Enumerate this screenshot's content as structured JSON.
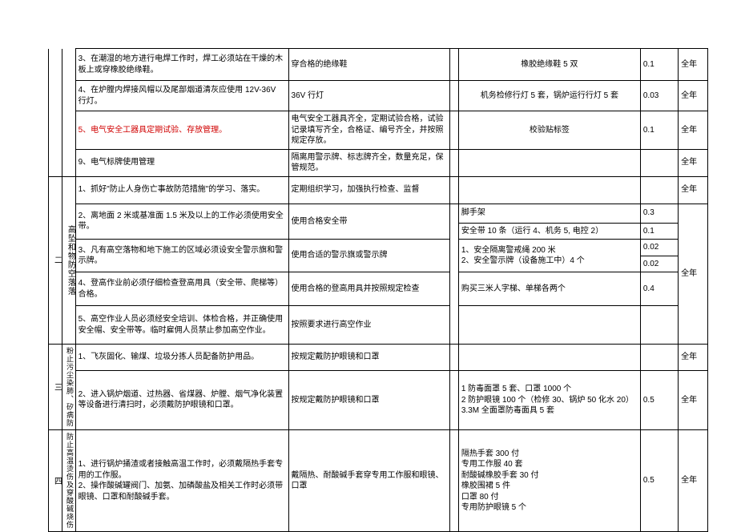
{
  "sections": {
    "s2_idx": "二",
    "s2_cat": "高坠和物防空落落",
    "s3_idx": "三",
    "s3_cat": "粉止污尘染肺、矽病防",
    "s4_idx": "四",
    "s4_cat": "防止高温烫伤及穿酸碱烧伤"
  },
  "rows": {
    "r1": {
      "item": "3、在潮湿的地方进行电焊工作时，焊工必须站在干燥的木板上或穿橡胶绝缘鞋。",
      "std": "穿合格的绝缘鞋",
      "mat": "橡胶绝缘鞋 5 双",
      "amt": "0.1",
      "per": "全年"
    },
    "r2": {
      "item": "4、在炉膛内焊接风帽以及尾部烟道清灰应使用 12V-36V 行灯。",
      "std": "36V 行灯",
      "mat": "机务检修行灯 5 套，锅炉运行行灯 5 套",
      "amt": "0.03",
      "per": "全年"
    },
    "r3": {
      "item": "5、电气安全工器具定期试验、存放管理。",
      "std": "电气安全工器具齐全，定期试验合格，试验记录填写齐全，合格证、编号齐全，并按照规定存放。",
      "mat": "校验贴标签",
      "amt": "0.1",
      "per": "全年"
    },
    "r4": {
      "item": "9、电气标牌使用管理",
      "std": "隔离用警示牌、标志牌齐全，数量充足，保管规范。",
      "mat": "",
      "amt": "",
      "per": "全年"
    },
    "r5": {
      "item": "1、抓好\"防止人身伤亡事故防范措施\"的学习、落实。",
      "std": "定期组织学习，加强执行检查、监督",
      "mat": "",
      "amt": "",
      "per": "全年"
    },
    "r6": {
      "item": "2、离地面 2 米或基准面 1.5 米及以上的工作必须使用安全带。",
      "std": "使用合格安全带",
      "mat1": "脚手架",
      "amt1": "0.3",
      "mat2": "安全带 10 条（运行 4、机务 5, 电控 2）",
      "amt2": "0.1"
    },
    "r7": {
      "item": "3、凡有高空落物和地下施工的区域必须设安全警示旗和警示牌。",
      "std": "使用合适的警示旗或警示牌",
      "mat1": "1、安全隔离警戒绳 200 米",
      "amt1": "0.02",
      "mat2": "2、安全警示牌（设备施工中）4 个",
      "amt2": "0.02"
    },
    "r8": {
      "item": "4、登高作业前必须仔细检查登高用具（安全带、爬梯等）合格。",
      "std": "使用合格的登高用具并按照规定检查",
      "mat": "购买三米人字梯、单梯各两个",
      "amt": "0.4",
      "per": "全年"
    },
    "r9": {
      "item": "5、高空作业人员必须经安全培训、体检合格，并正确使用安全帽、安全带等。临时雇佣人员禁止参加高空作业。",
      "std": "按照要求进行高空作业",
      "mat": "",
      "amt": ""
    },
    "r10": {
      "item": "1、飞灰固化、输煤、垃圾分拣人员配备防护用品。",
      "std": "按规定戴防护眼镜和口罩",
      "mat": "",
      "amt": "",
      "per": "全年"
    },
    "r11": {
      "item": "2、进入锅炉烟道、过热器、省煤器、炉膛、烟气净化装置等设备进行清扫时，必须戴防护眼镜和口罩。",
      "std": "按规定戴防护眼镜和口罩",
      "mat": "1 防毒面罩 5 套、口罩 1000 个\n2 防护眼镜 100 个（检修 30、锅炉 50 化水 20）\n3.3M 全面罩防毒面具 5 套",
      "amt": "0.5",
      "per": "全年"
    },
    "r12": {
      "item": "1、进行锅炉捅渣或者接触高温工作时，必须戴隔热手套专用的工作服。\n2、操作酸碱罐阀门、加氨、加磷酸盐及相关工作时必须带眼镜、口罩和耐酸碱手套。",
      "std": "戴隔热、耐酸碱手套穿专用工作服和眼镜、口罩",
      "mat": "隔热手套 300 付\n专用工作服 40 套\n耐酸碱橡胶手套 30 付\n橡胶围裙 5 件\n口罩 80 付\n专用防护眼镜 5 个",
      "amt": "0.5",
      "per": "全年"
    }
  }
}
